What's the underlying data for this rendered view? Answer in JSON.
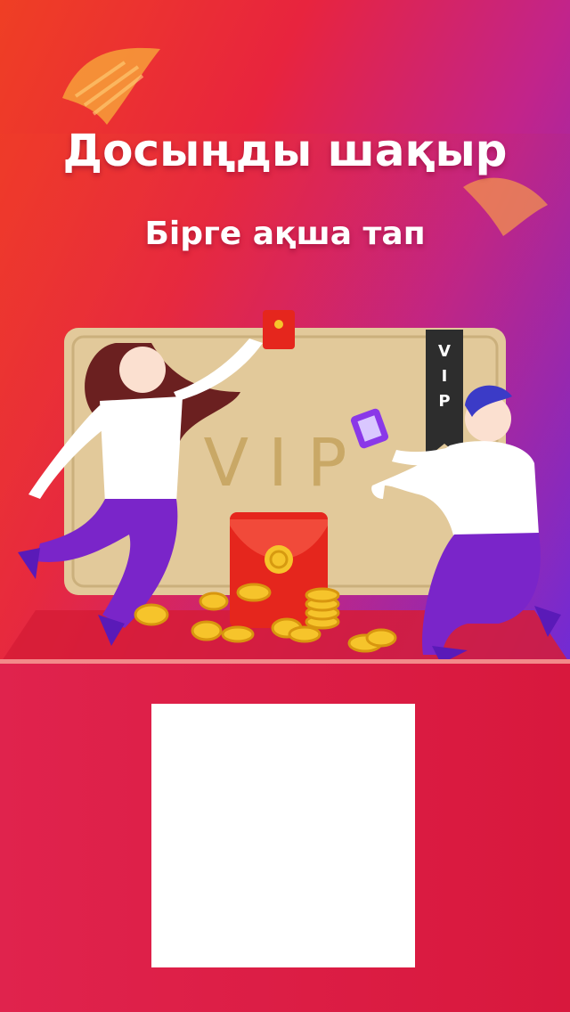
{
  "header": {
    "title": "Досыңды шақыр",
    "subtitle": "Бірге ақша тап"
  },
  "illustration": {
    "card_text": "VIP",
    "tag_text": "VIP"
  },
  "colors": {
    "hero_left": "#ef3f24",
    "hero_right": "#6f2cd6",
    "bottom_panel": "#d8183d",
    "card_gold": "#e2c99a",
    "envelope_red": "#e5261d",
    "coin_gold": "#f6c42b",
    "qr_placeholder": "#ffffff"
  }
}
